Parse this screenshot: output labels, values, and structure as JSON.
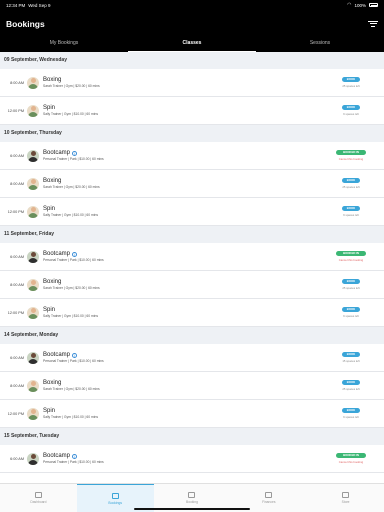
{
  "status_bar": {
    "time": "12:34 PM",
    "date": "Wed Sep 9",
    "battery": "100%"
  },
  "header": {
    "title": "Bookings"
  },
  "tabs": [
    {
      "label": "My Bookings",
      "active": false
    },
    {
      "label": "Classes",
      "active": true
    },
    {
      "label": "Sessions",
      "active": false
    }
  ],
  "days": [
    {
      "date": "09 September, Wednesday",
      "classes": [
        {
          "time": "8:00 AM",
          "name": "Boxing",
          "details": "Sarah Trainer | Gym | $20.00 | 60 mins",
          "status": "book",
          "action": "BOOK",
          "note": "25 spaces left",
          "info": false,
          "avatar": "woman"
        },
        {
          "time": "12:00 PM",
          "name": "Spin",
          "details": "Sally Trainer | Gym | $10.00 | 60 mins",
          "status": "book",
          "action": "BOOK",
          "note": "9 spaces left",
          "info": false,
          "avatar": "woman"
        }
      ]
    },
    {
      "date": "10 September, Thursday",
      "classes": [
        {
          "time": "6:00 AM",
          "name": "Bootcamp",
          "details": "Personal Trainer | Park | $10.00 | 60 mins",
          "status": "booked",
          "action": "BOOKED IN",
          "note": "Cancel this booking",
          "info": true,
          "avatar": "man"
        },
        {
          "time": "8:00 AM",
          "name": "Boxing",
          "details": "Sarah Trainer | Gym | $20.00 | 60 mins",
          "status": "book",
          "action": "BOOK",
          "note": "25 spaces left",
          "info": false,
          "avatar": "woman"
        },
        {
          "time": "12:00 PM",
          "name": "Spin",
          "details": "Sally Trainer | Gym | $10.00 | 60 mins",
          "status": "book",
          "action": "BOOK",
          "note": "9 spaces left",
          "info": false,
          "avatar": "woman"
        }
      ]
    },
    {
      "date": "11 September, Friday",
      "classes": [
        {
          "time": "6:00 AM",
          "name": "Bootcamp",
          "details": "Personal Trainer | Park | $10.00 | 60 mins",
          "status": "booked",
          "action": "BOOKED IN",
          "note": "Cancel this booking",
          "info": true,
          "avatar": "man"
        },
        {
          "time": "8:00 AM",
          "name": "Boxing",
          "details": "Sarah Trainer | Gym | $20.00 | 60 mins",
          "status": "book",
          "action": "BOOK",
          "note": "25 spaces left",
          "info": false,
          "avatar": "woman"
        },
        {
          "time": "12:00 PM",
          "name": "Spin",
          "details": "Sally Trainer | Gym | $10.00 | 60 mins",
          "status": "book",
          "action": "BOOK",
          "note": "9 spaces left",
          "info": false,
          "avatar": "woman"
        }
      ]
    },
    {
      "date": "14 September, Monday",
      "classes": [
        {
          "time": "6:00 AM",
          "name": "Bootcamp",
          "details": "Personal Trainer | Park | $10.00 | 60 mins",
          "status": "book",
          "action": "BOOK",
          "note": "15 spaces left",
          "info": true,
          "avatar": "man"
        },
        {
          "time": "8:00 AM",
          "name": "Boxing",
          "details": "Sarah Trainer | Gym | $20.00 | 60 mins",
          "status": "book",
          "action": "BOOK",
          "note": "25 spaces left",
          "info": false,
          "avatar": "woman"
        },
        {
          "time": "12:00 PM",
          "name": "Spin",
          "details": "Sally Trainer | Gym | $10.00 | 60 mins",
          "status": "book",
          "action": "BOOK",
          "note": "9 spaces left",
          "info": false,
          "avatar": "woman"
        }
      ]
    },
    {
      "date": "15 September, Tuesday",
      "classes": [
        {
          "time": "6:00 AM",
          "name": "Bootcamp",
          "details": "Personal Trainer | Park | $10.00 | 60 mins",
          "status": "booked",
          "action": "BOOKED IN",
          "note": "Cancel this booking",
          "info": true,
          "avatar": "man"
        }
      ]
    }
  ],
  "bottom_nav": [
    {
      "label": "Dashboard",
      "icon": "dashboard-icon",
      "active": false
    },
    {
      "label": "Bookings",
      "icon": "calendar-icon",
      "active": true
    },
    {
      "label": "Booking",
      "icon": "dumbbell-icon",
      "active": false
    },
    {
      "label": "Finances",
      "icon": "wallet-icon",
      "active": false
    },
    {
      "label": "Store",
      "icon": "store-icon",
      "active": false
    }
  ],
  "colors": {
    "book": "#3aa5d8",
    "booked": "#3bb774",
    "cancel": "#e06868",
    "header_bg": "#000000",
    "day_header_bg": "#eef1f5"
  }
}
